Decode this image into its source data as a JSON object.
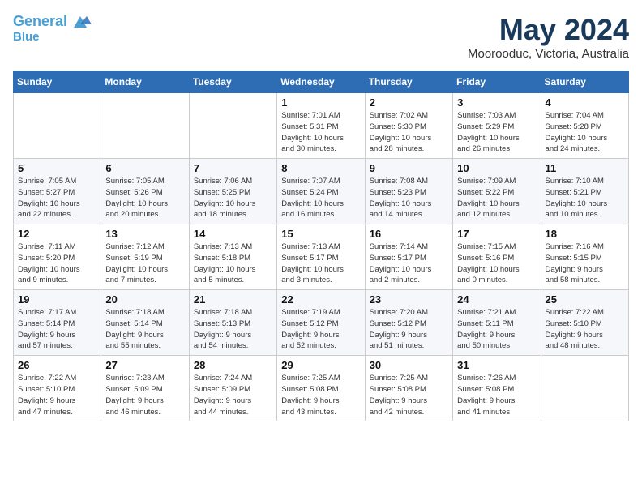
{
  "header": {
    "logo_line1": "General",
    "logo_line2": "Blue",
    "month": "May 2024",
    "location": "Moorooduc, Victoria, Australia"
  },
  "weekdays": [
    "Sunday",
    "Monday",
    "Tuesday",
    "Wednesday",
    "Thursday",
    "Friday",
    "Saturday"
  ],
  "weeks": [
    [
      {
        "day": "",
        "info": ""
      },
      {
        "day": "",
        "info": ""
      },
      {
        "day": "",
        "info": ""
      },
      {
        "day": "1",
        "info": "Sunrise: 7:01 AM\nSunset: 5:31 PM\nDaylight: 10 hours\nand 30 minutes."
      },
      {
        "day": "2",
        "info": "Sunrise: 7:02 AM\nSunset: 5:30 PM\nDaylight: 10 hours\nand 28 minutes."
      },
      {
        "day": "3",
        "info": "Sunrise: 7:03 AM\nSunset: 5:29 PM\nDaylight: 10 hours\nand 26 minutes."
      },
      {
        "day": "4",
        "info": "Sunrise: 7:04 AM\nSunset: 5:28 PM\nDaylight: 10 hours\nand 24 minutes."
      }
    ],
    [
      {
        "day": "5",
        "info": "Sunrise: 7:05 AM\nSunset: 5:27 PM\nDaylight: 10 hours\nand 22 minutes."
      },
      {
        "day": "6",
        "info": "Sunrise: 7:05 AM\nSunset: 5:26 PM\nDaylight: 10 hours\nand 20 minutes."
      },
      {
        "day": "7",
        "info": "Sunrise: 7:06 AM\nSunset: 5:25 PM\nDaylight: 10 hours\nand 18 minutes."
      },
      {
        "day": "8",
        "info": "Sunrise: 7:07 AM\nSunset: 5:24 PM\nDaylight: 10 hours\nand 16 minutes."
      },
      {
        "day": "9",
        "info": "Sunrise: 7:08 AM\nSunset: 5:23 PM\nDaylight: 10 hours\nand 14 minutes."
      },
      {
        "day": "10",
        "info": "Sunrise: 7:09 AM\nSunset: 5:22 PM\nDaylight: 10 hours\nand 12 minutes."
      },
      {
        "day": "11",
        "info": "Sunrise: 7:10 AM\nSunset: 5:21 PM\nDaylight: 10 hours\nand 10 minutes."
      }
    ],
    [
      {
        "day": "12",
        "info": "Sunrise: 7:11 AM\nSunset: 5:20 PM\nDaylight: 10 hours\nand 9 minutes."
      },
      {
        "day": "13",
        "info": "Sunrise: 7:12 AM\nSunset: 5:19 PM\nDaylight: 10 hours\nand 7 minutes."
      },
      {
        "day": "14",
        "info": "Sunrise: 7:13 AM\nSunset: 5:18 PM\nDaylight: 10 hours\nand 5 minutes."
      },
      {
        "day": "15",
        "info": "Sunrise: 7:13 AM\nSunset: 5:17 PM\nDaylight: 10 hours\nand 3 minutes."
      },
      {
        "day": "16",
        "info": "Sunrise: 7:14 AM\nSunset: 5:17 PM\nDaylight: 10 hours\nand 2 minutes."
      },
      {
        "day": "17",
        "info": "Sunrise: 7:15 AM\nSunset: 5:16 PM\nDaylight: 10 hours\nand 0 minutes."
      },
      {
        "day": "18",
        "info": "Sunrise: 7:16 AM\nSunset: 5:15 PM\nDaylight: 9 hours\nand 58 minutes."
      }
    ],
    [
      {
        "day": "19",
        "info": "Sunrise: 7:17 AM\nSunset: 5:14 PM\nDaylight: 9 hours\nand 57 minutes."
      },
      {
        "day": "20",
        "info": "Sunrise: 7:18 AM\nSunset: 5:14 PM\nDaylight: 9 hours\nand 55 minutes."
      },
      {
        "day": "21",
        "info": "Sunrise: 7:18 AM\nSunset: 5:13 PM\nDaylight: 9 hours\nand 54 minutes."
      },
      {
        "day": "22",
        "info": "Sunrise: 7:19 AM\nSunset: 5:12 PM\nDaylight: 9 hours\nand 52 minutes."
      },
      {
        "day": "23",
        "info": "Sunrise: 7:20 AM\nSunset: 5:12 PM\nDaylight: 9 hours\nand 51 minutes."
      },
      {
        "day": "24",
        "info": "Sunrise: 7:21 AM\nSunset: 5:11 PM\nDaylight: 9 hours\nand 50 minutes."
      },
      {
        "day": "25",
        "info": "Sunrise: 7:22 AM\nSunset: 5:10 PM\nDaylight: 9 hours\nand 48 minutes."
      }
    ],
    [
      {
        "day": "26",
        "info": "Sunrise: 7:22 AM\nSunset: 5:10 PM\nDaylight: 9 hours\nand 47 minutes."
      },
      {
        "day": "27",
        "info": "Sunrise: 7:23 AM\nSunset: 5:09 PM\nDaylight: 9 hours\nand 46 minutes."
      },
      {
        "day": "28",
        "info": "Sunrise: 7:24 AM\nSunset: 5:09 PM\nDaylight: 9 hours\nand 44 minutes."
      },
      {
        "day": "29",
        "info": "Sunrise: 7:25 AM\nSunset: 5:08 PM\nDaylight: 9 hours\nand 43 minutes."
      },
      {
        "day": "30",
        "info": "Sunrise: 7:25 AM\nSunset: 5:08 PM\nDaylight: 9 hours\nand 42 minutes."
      },
      {
        "day": "31",
        "info": "Sunrise: 7:26 AM\nSunset: 5:08 PM\nDaylight: 9 hours\nand 41 minutes."
      },
      {
        "day": "",
        "info": ""
      }
    ]
  ]
}
